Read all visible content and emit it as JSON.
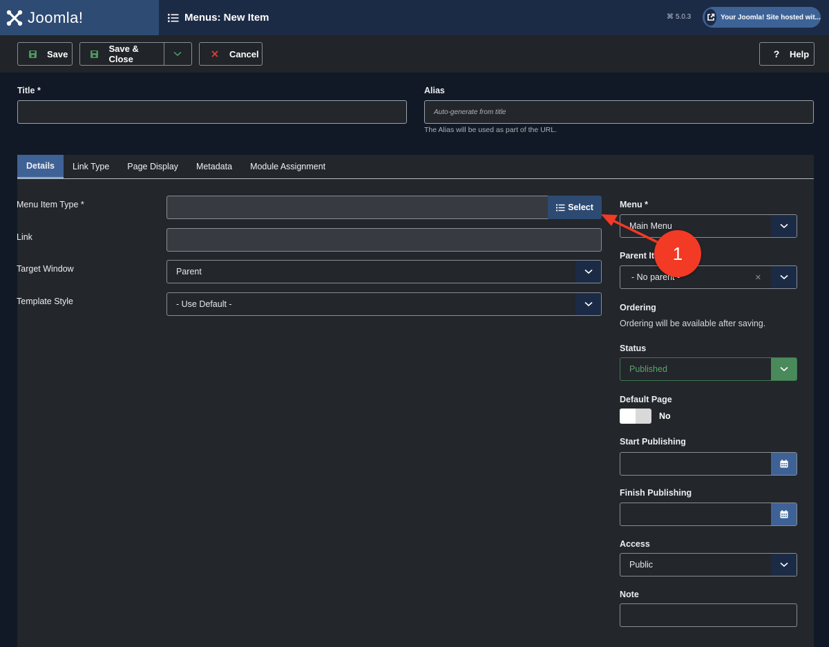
{
  "header": {
    "logo_text": "Joomla!",
    "page_title": "Menus: New Item",
    "version": "5.0.3",
    "site_link": "Your Joomla! Site hosted wit..."
  },
  "toolbar": {
    "save_label": "Save",
    "save_close_label": "Save & Close",
    "cancel_label": "Cancel",
    "help_label": "Help"
  },
  "form": {
    "title_label": "Title *",
    "title_value": "",
    "alias_label": "Alias",
    "alias_placeholder": "Auto-generate from title",
    "alias_help": "The Alias will be used as part of the URL."
  },
  "tabs": [
    {
      "label": "Details",
      "active": true
    },
    {
      "label": "Link Type"
    },
    {
      "label": "Page Display"
    },
    {
      "label": "Metadata"
    },
    {
      "label": "Module Assignment"
    }
  ],
  "details": {
    "menu_item_type_label": "Menu Item Type *",
    "menu_item_type_value": "",
    "select_label": "Select",
    "link_label": "Link",
    "link_value": "",
    "target_window_label": "Target Window",
    "target_window_value": "Parent",
    "template_style_label": "Template Style",
    "template_style_value": "- Use Default -"
  },
  "sidebar": {
    "menu_label": "Menu *",
    "menu_value": "Main Menu",
    "parent_item_label": "Parent Item",
    "parent_item_value": "- No parent -",
    "ordering_label": "Ordering",
    "ordering_text": "Ordering will be available after saving.",
    "status_label": "Status",
    "status_value": "Published",
    "default_page_label": "Default Page",
    "default_page_value": "No",
    "start_publishing_label": "Start Publishing",
    "start_publishing_value": "",
    "finish_publishing_label": "Finish Publishing",
    "finish_publishing_value": "",
    "access_label": "Access",
    "access_value": "Public",
    "note_label": "Note",
    "note_value": ""
  },
  "annotation": {
    "number": "1",
    "color": "#f23a25"
  },
  "colors": {
    "header_bg": "#1c2b45",
    "logo_bg": "#2e4b74",
    "accent": "#3f6296",
    "status_green": "#4a8a5a"
  }
}
